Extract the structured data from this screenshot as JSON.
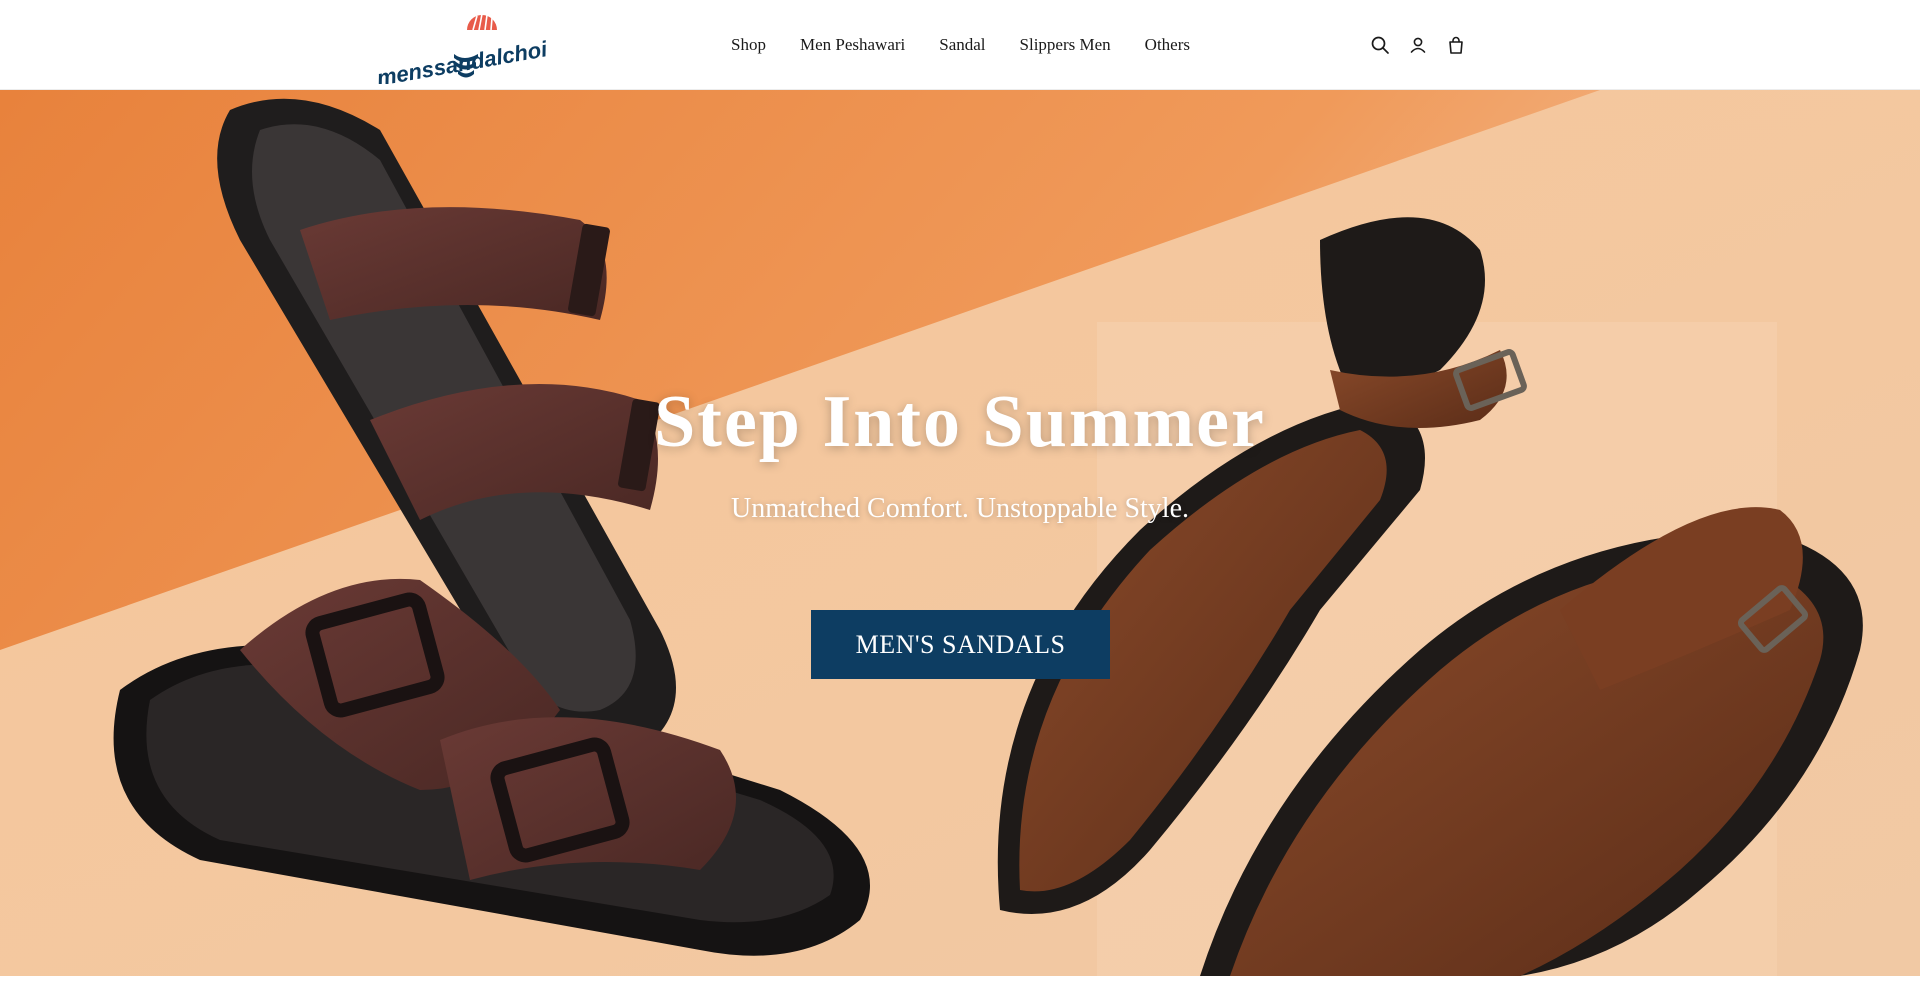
{
  "brand": {
    "name": "menssandalchoi",
    "colors": {
      "primary": "#0d3d62",
      "accent": "#e85b4a"
    }
  },
  "nav": {
    "items": [
      {
        "label": "Shop"
      },
      {
        "label": "Men Peshawari"
      },
      {
        "label": "Sandal"
      },
      {
        "label": "Slippers Men"
      },
      {
        "label": "Others"
      }
    ]
  },
  "header_icons": [
    "search-icon",
    "account-icon",
    "cart-icon"
  ],
  "hero": {
    "title": "Step Into Summer",
    "subtitle": "Unmatched Comfort. Unstoppable Style.",
    "cta_label": "MEN'S SANDALS",
    "cta_color": "#0d3d62"
  }
}
